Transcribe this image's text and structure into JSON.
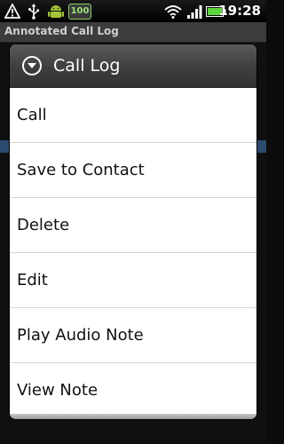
{
  "status_bar": {
    "battery_badge": "100",
    "time": "19:28",
    "icons": [
      "warning-icon",
      "usb-icon",
      "android-icon",
      "wifi-icon",
      "signal-icon",
      "battery-icon"
    ]
  },
  "app": {
    "title": "Annotated Call Log"
  },
  "dialog": {
    "title": "Call Log",
    "header_icon": "chevron-down-circle-icon",
    "items": [
      {
        "label": "Call"
      },
      {
        "label": "Save to Contact"
      },
      {
        "label": "Delete"
      },
      {
        "label": "Edit"
      },
      {
        "label": "Play Audio Note"
      },
      {
        "label": "View Note"
      }
    ]
  },
  "colors": {
    "battery_green": "#8ad06a",
    "header_dark": "#3e3e3e",
    "divider": "#d4d4d4"
  }
}
